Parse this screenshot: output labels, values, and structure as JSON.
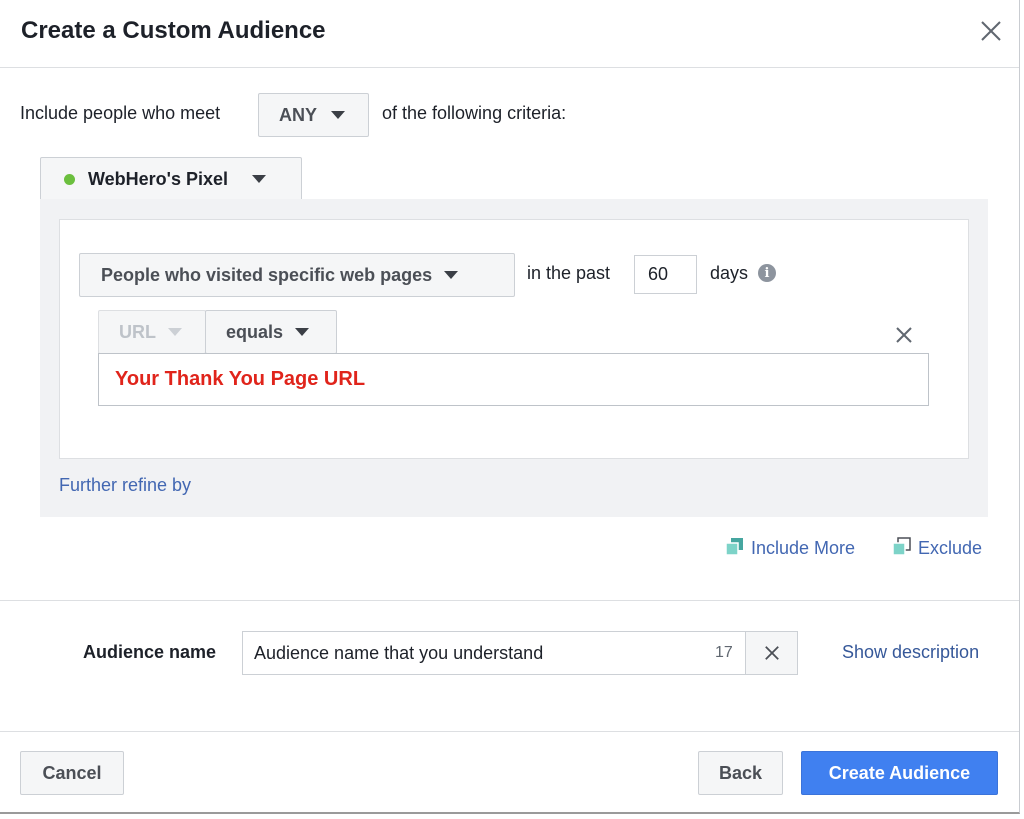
{
  "dialog": {
    "title": "Create a Custom Audience"
  },
  "criteria": {
    "prefix": "Include people who meet",
    "match_value": "ANY",
    "suffix": "of the following criteria:"
  },
  "pixel": {
    "name": "WebHero's Pixel",
    "status_color": "#6bbf3e"
  },
  "rule": {
    "event": "People who visited specific web pages",
    "in_the_past": "in the past",
    "days_value": "60",
    "days_label": "days",
    "field": "URL",
    "operator": "equals",
    "url_value": "Your Thank You Page URL",
    "url_value_color": "#e0241b"
  },
  "refine": {
    "label": "Further refine by"
  },
  "actions": {
    "include_more": "Include More",
    "exclude": "Exclude"
  },
  "audience_name": {
    "label": "Audience name",
    "value": "Audience name that you understand",
    "char_count": "17",
    "show_description": "Show description"
  },
  "footer": {
    "cancel": "Cancel",
    "back": "Back",
    "create": "Create Audience"
  },
  "colors": {
    "primary_button": "#4080f0",
    "link": "#4267b2"
  }
}
